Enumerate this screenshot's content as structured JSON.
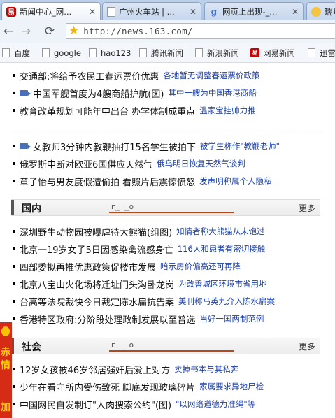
{
  "tabs": [
    {
      "title": "新闻中心_网...",
      "favicon": "163-icon",
      "active": true
    },
    {
      "title": "广州火车站 | ...",
      "favicon": "page-icon",
      "active": false
    },
    {
      "title": "网页上出现-_...",
      "favicon": "google-icon",
      "active": false
    },
    {
      "title": "瑞星",
      "favicon": "face-icon",
      "active": false
    }
  ],
  "toolbar": {
    "back": "←",
    "forward": "→",
    "reload": "⟳",
    "home": "⌂",
    "url": "http://news.163.com/"
  },
  "bookmarks": [
    "百度",
    "google",
    "hao123",
    "腾讯新闻",
    "新浪新闻",
    "网易新闻",
    "迅雷"
  ],
  "news_block_1": [
    {
      "headline": "交通部:将给予农民工春运票价优惠",
      "sub": "各地暂无调整春运票价政策",
      "video": false
    },
    {
      "headline": "中国军舰首度为4艘商船护航(图)",
      "sub": "其中一艘为中国香港商船",
      "video": true
    },
    {
      "headline": "教育改革规划可能年中出台 办学体制成重点",
      "sub": "温家宝挂帅力推",
      "video": false
    }
  ],
  "news_block_2": [
    {
      "headline": "女教师3分钟内教鞭抽打15名学生被拍下",
      "sub": "被学生称作\"教鞭老师\"",
      "video": true
    },
    {
      "headline": "俄罗斯中断对欧亚6国供应天然气",
      "sub": "俄乌明日恢复天然气谈判",
      "video": false
    },
    {
      "headline": "章子怡与男友度假遭偷拍 看照片后震惊愤怒",
      "sub": "发声明称属个人隐私",
      "video": false
    }
  ],
  "section_guonei": {
    "title": "国内",
    "deco": "r_ _o",
    "more": "更多",
    "items": [
      {
        "headline": "深圳野生动物园被曝虐待大熊猫(组图)",
        "sub": "知情者称大熊猫从未饱过"
      },
      {
        "headline": "北京一19岁女子5日因感染禽流感身亡",
        "sub": "116人和患者有密切接触"
      },
      {
        "headline": "四部委拟再推优惠政策促楼市发展",
        "sub": "暗示房价偏高还可再降"
      },
      {
        "headline": "北京八宝山火化场将迁址门头沟卧龙岗",
        "sub": "为改善城区环境市省用地"
      },
      {
        "headline": "台高等法院裁快今日裁定陈水扁抗告案",
        "sub": "美刊称马英九介入陈水扁案"
      },
      {
        "headline": "香港特区政府:分阶段处理政制发展以至普选",
        "sub": "当好一国两制范例"
      }
    ]
  },
  "section_shehui": {
    "title": "社会",
    "deco": "r_ _o",
    "more": "更多",
    "items": [
      {
        "headline": "12岁女孩被46岁邻居强奸后爱上对方",
        "sub": "卖掉书本与其私奔"
      },
      {
        "headline": "少年在看守所内受伤致死 脚底发现玻璃碎片",
        "sub": "家属要求异地尸检"
      },
      {
        "headline": "中国网民自发制订\"人肉搜索公约\"(图)",
        "sub": "\"以网络道德为准绳\"等"
      }
    ]
  },
  "side_ad": {
    "chars": [
      "赤",
      "情",
      "加"
    ]
  },
  "colors": {
    "link_blue": "#1a3da8",
    "section_accent": "#b8481a",
    "ad_red": "#d62c16"
  }
}
